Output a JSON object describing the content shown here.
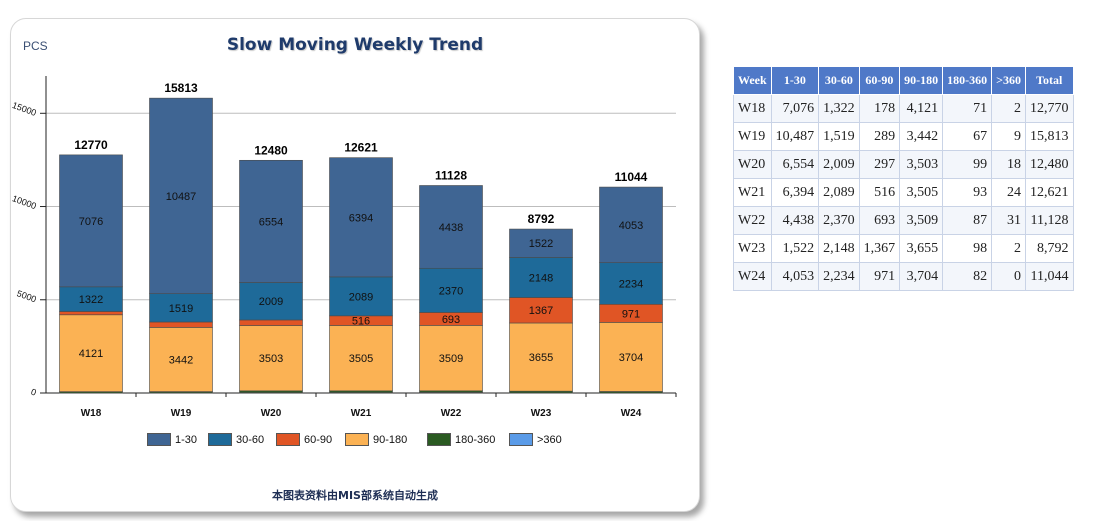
{
  "chart": {
    "unit_label": "PCS",
    "footer": "本图表资料由MIS部系统自动生成"
  },
  "colors": {
    "1-30": "#3f6593",
    "30-60": "#1e6a99",
    "60-90": "#e05525",
    "90-180": "#fbb254",
    "180-360": "#2a5a22",
    "360+": "#5a9be8"
  },
  "chart_data": {
    "type": "bar",
    "stacked": true,
    "title": "Slow Moving Weekly Trend",
    "categories": [
      "W18",
      "W19",
      "W20",
      "W21",
      "W22",
      "W23",
      "W24"
    ],
    "series": [
      {
        "name": "1-30",
        "values": [
          7076,
          10487,
          6554,
          6394,
          4438,
          1522,
          4053
        ]
      },
      {
        "name": "30-60",
        "values": [
          1322,
          1519,
          2009,
          2089,
          2370,
          2148,
          2234
        ]
      },
      {
        "name": "60-90",
        "values": [
          178,
          289,
          297,
          516,
          693,
          1367,
          971
        ]
      },
      {
        "name": "90-180",
        "values": [
          4121,
          3442,
          3503,
          3505,
          3509,
          3655,
          3704
        ]
      },
      {
        "name": "180-360",
        "values": [
          71,
          67,
          99,
          93,
          87,
          98,
          82
        ]
      },
      {
        "name": ">360",
        "values": [
          2,
          9,
          18,
          24,
          31,
          2,
          0
        ]
      }
    ],
    "totals": [
      12770,
      15813,
      12480,
      12621,
      11128,
      8792,
      11044
    ],
    "y_ticks": [
      0,
      5000,
      10000,
      15000
    ],
    "ylim": [
      0,
      17000
    ],
    "grid": true,
    "legend": "bottom"
  },
  "table": {
    "headers": [
      "Week",
      "1-30",
      "30-60",
      "60-90",
      "90-180",
      "180-360",
      ">360",
      "Total"
    ],
    "rows": [
      [
        "W18",
        "7,076",
        "1,322",
        "178",
        "4,121",
        "71",
        "2",
        "12,770"
      ],
      [
        "W19",
        "10,487",
        "1,519",
        "289",
        "3,442",
        "67",
        "9",
        "15,813"
      ],
      [
        "W20",
        "6,554",
        "2,009",
        "297",
        "3,503",
        "99",
        "18",
        "12,480"
      ],
      [
        "W21",
        "6,394",
        "2,089",
        "516",
        "3,505",
        "93",
        "24",
        "12,621"
      ],
      [
        "W22",
        "4,438",
        "2,370",
        "693",
        "3,509",
        "87",
        "31",
        "11,128"
      ],
      [
        "W23",
        "1,522",
        "2,148",
        "1,367",
        "3,655",
        "98",
        "2",
        "8,792"
      ],
      [
        "W24",
        "4,053",
        "2,234",
        "971",
        "3,704",
        "82",
        "0",
        "11,044"
      ]
    ]
  }
}
